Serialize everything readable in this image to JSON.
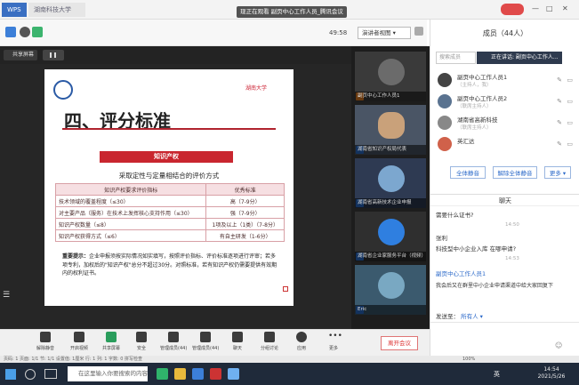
{
  "browser": {
    "tab1": "WPS 文字",
    "tab2": "湖南科技大学",
    "center_title": "现正在观看 副页中心工作人员_腾讯会议",
    "window_buttons": [
      "—",
      "□",
      "✕"
    ]
  },
  "meeting_bar": {
    "timecode": "49:58",
    "layout_button": "演讲者视图 ▾",
    "share_chip": "共享屏幕"
  },
  "slide": {
    "title": "四、评分标准",
    "red_band": "知识产权",
    "subtitle": "采取定性与定量相结合的评价方式",
    "table": {
      "headers": [
        "知识产权要求评价指标",
        "优秀标准"
      ],
      "rows": [
        [
          "技术领域的覆盖程度（≤30）",
          "高（7-9分）"
        ],
        [
          "对主要产品（服务）在技术上发挥核心支持作用（≤30）",
          "强（7-9分）"
        ],
        [
          "知识产权数量（≤8）",
          "1项及以上（1类）（7-8分）"
        ],
        [
          "知识产权获得方式（≤6）",
          "有自主研发（1-6分）"
        ]
      ]
    },
    "note_label": "重要提示：",
    "note_text": "企业申报须按实际情况如实填写，按照评价指标、评价标准逐项进行评审；若多项专利，加权后的\"知识产权\"总分不超过30分。对照标准，若有知识产权仍需要提供有效期内的权利证书。",
    "logo_text": "湖南大学"
  },
  "videos": [
    {
      "label": "副页中心工作人员1"
    },
    {
      "label": "湖南省知识产权局代表"
    },
    {
      "label": "湖南省高新技术企业申报"
    },
    {
      "label": "湖南省企业家服务平台（视频）"
    },
    {
      "label": "Eric"
    }
  ],
  "participants": {
    "title": "成员（44人）",
    "search_placeholder": "搜索成员",
    "popup": "正在讲话: 副页中心工作人...",
    "members": [
      {
        "name": "副页中心工作人员1",
        "sub": "（主持人，我）"
      },
      {
        "name": "副页中心工作人员2",
        "sub": "（联席主持人）"
      },
      {
        "name": "湖南省高新科技",
        "sub": "（联席主持人）"
      },
      {
        "name": "英汇达",
        "sub": ""
      }
    ],
    "buttons": [
      "全体静音",
      "解除全体静音",
      "更多 ▾"
    ]
  },
  "chat": {
    "header": "聊天",
    "messages": [
      {
        "text": "需要什么证书?",
        "time": "14:50"
      },
      {
        "text": "张利",
        "time": ""
      },
      {
        "text": "科技型中小企业入库 在哪申请?",
        "time": "14:53"
      },
      {
        "text": "副页中心工作人员1",
        "time": "",
        "sender": true
      },
      {
        "text": "我会后又在群里中小企业申请渠道中给大家回复下",
        "time": ""
      }
    ],
    "send_to_label": "发送至：",
    "send_to_value": "所有人 ▾"
  },
  "controls": [
    "解除静音",
    "开启视频",
    "共享屏幕",
    "安全",
    "管理成员(44)",
    "管理成员(44)",
    "聊天",
    "分组讨论",
    "应用",
    "更多"
  ],
  "end_button": "离开会议",
  "status": {
    "left": "页码: 1  页面: 1/1  节: 1/1  设置值: 1厘米  行: 1  列: 1  字数: 0  拼写检查",
    "zoom": "100%"
  },
  "taskbar": {
    "search": "在这里输入你要搜索的内容",
    "ime": "英",
    "time": "14:54",
    "date": "2021/5/26"
  }
}
